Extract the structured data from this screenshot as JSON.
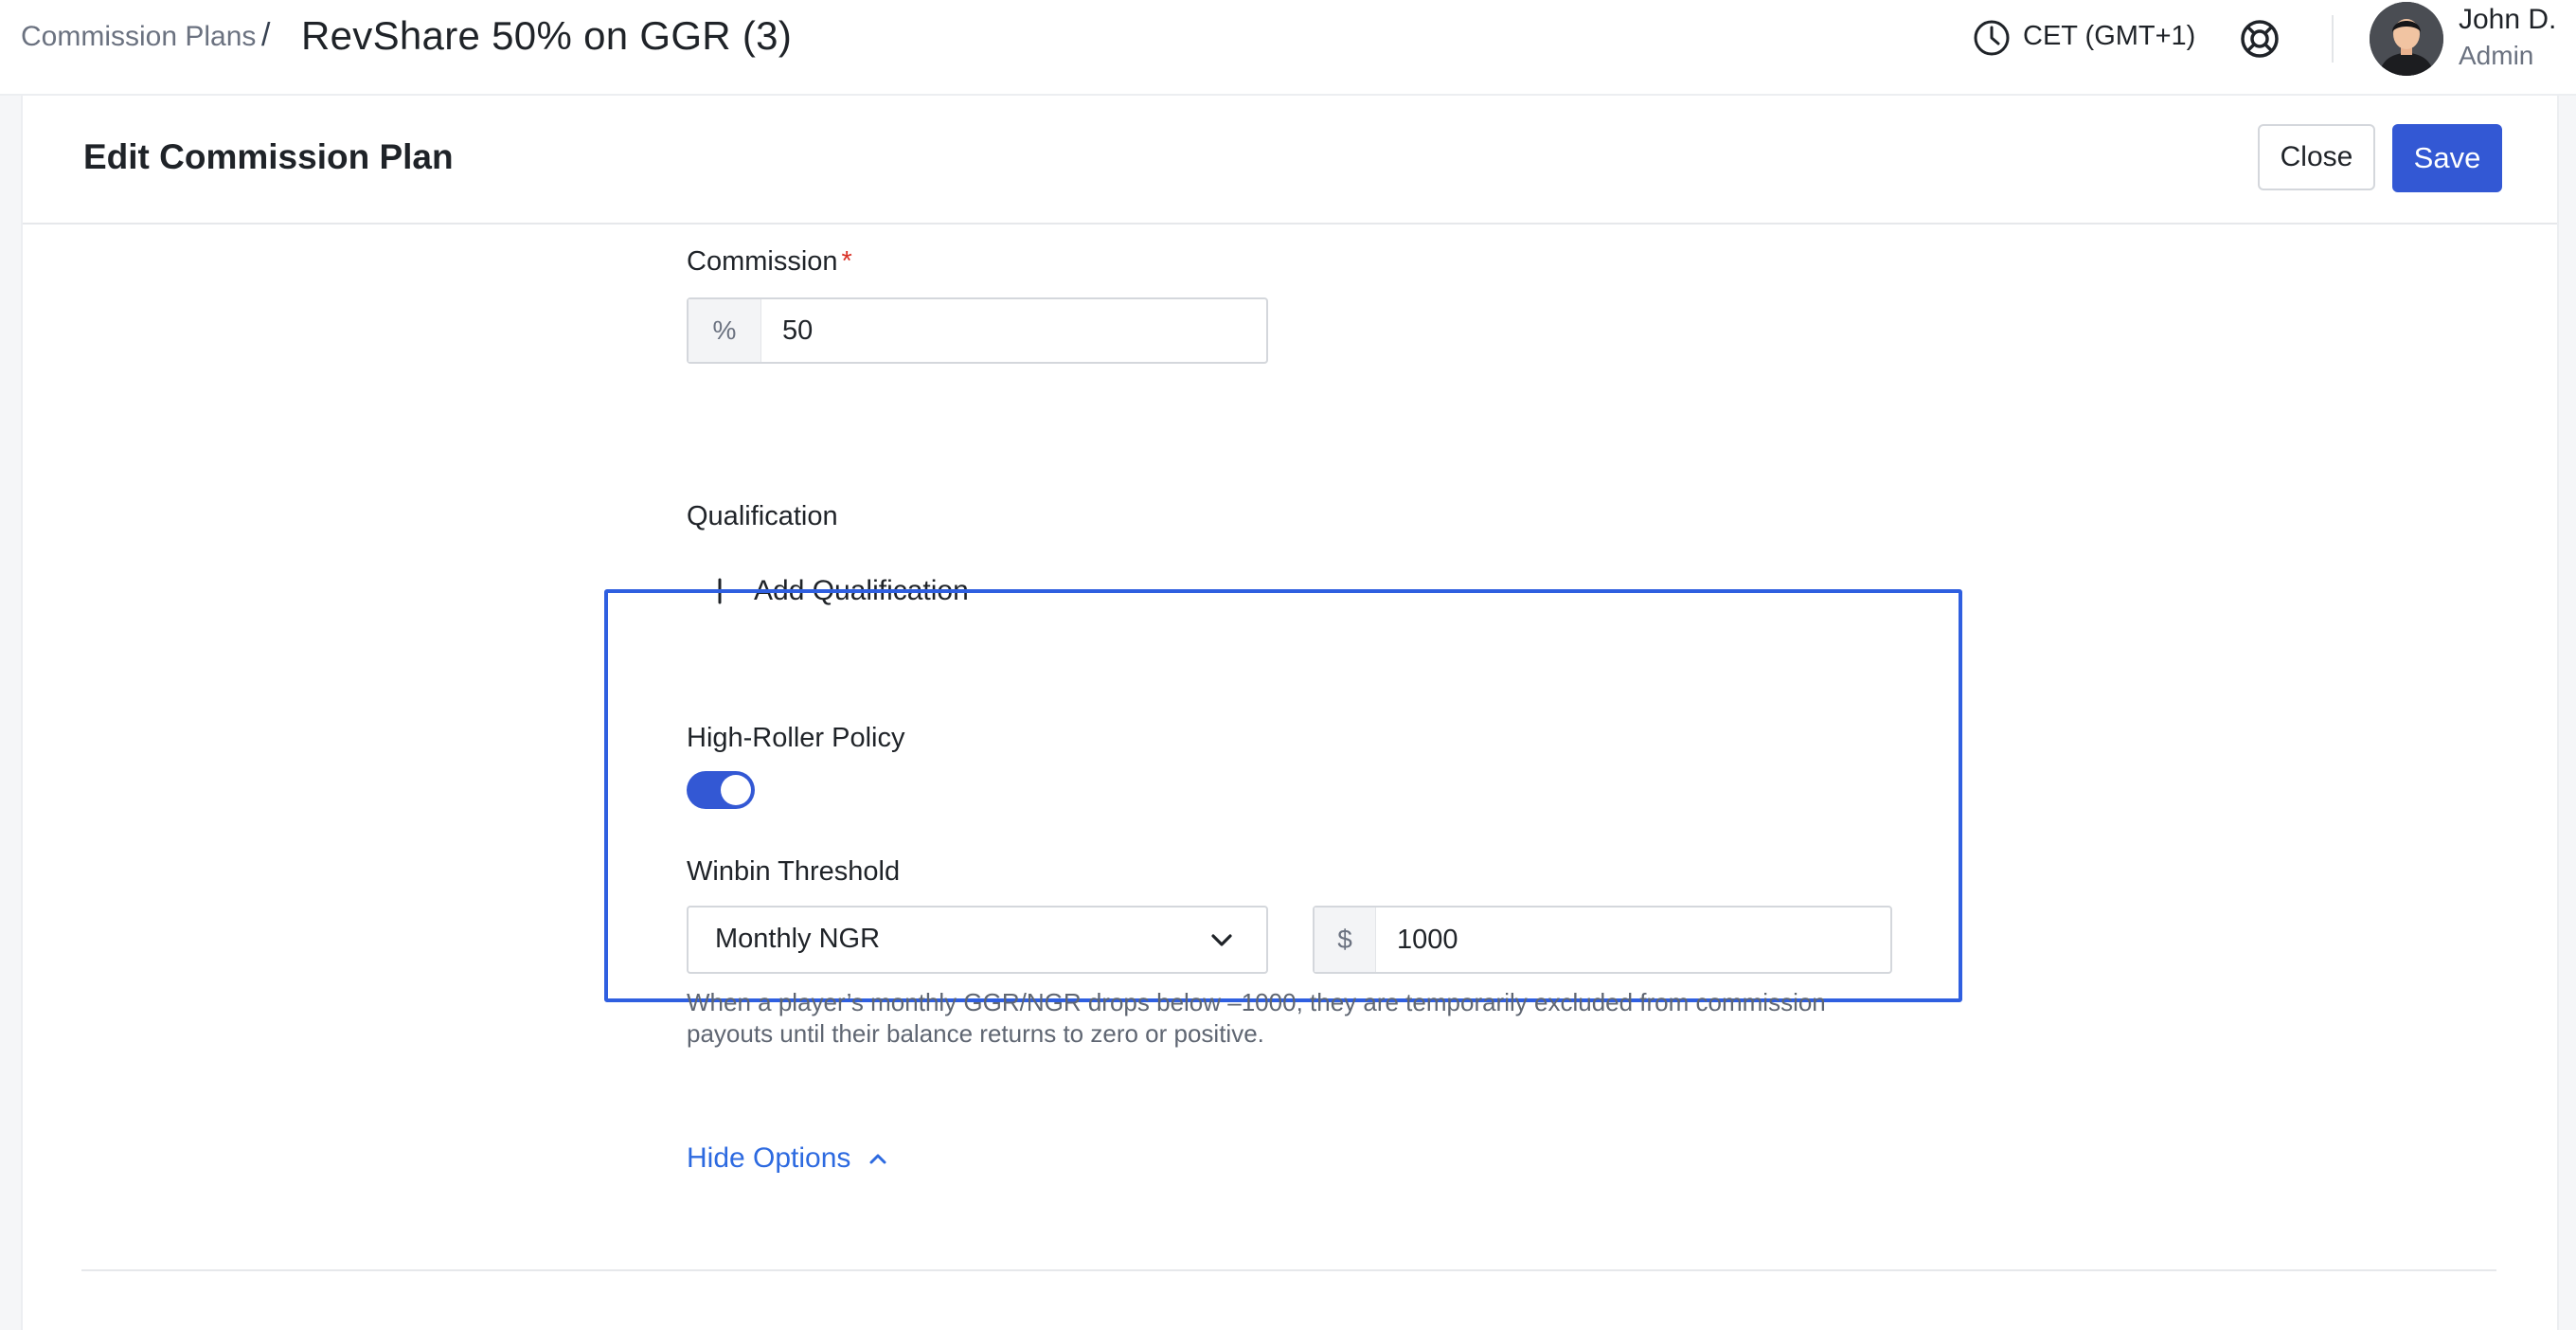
{
  "breadcrumb": {
    "parent": "Commission Plans",
    "separator": "/",
    "title": "RevShare 50% on GGR (3)"
  },
  "header": {
    "timezone": "CET (GMT+1)",
    "user_name": "John D.",
    "user_role": "Admin"
  },
  "panel": {
    "title": "Edit Commission Plan",
    "close_label": "Close",
    "save_label": "Save"
  },
  "commission": {
    "label": "Commission",
    "required_mark": "*",
    "prefix": "%",
    "value": "50"
  },
  "qualification": {
    "label": "Qualification",
    "add_label": "Add Qualification"
  },
  "high_roller": {
    "label": "High-Roller Policy",
    "enabled": true,
    "threshold_label": "Winbin Threshold",
    "threshold_type": "Monthly NGR",
    "amount_prefix": "$",
    "amount": "1000",
    "help_text": "When a player’s monthly GGR/NGR drops below –1000, they are temporarily excluded from commission payouts until their balance returns to zero or positive."
  },
  "options": {
    "hide_label": "Hide Options"
  },
  "colors": {
    "primary": "#3358d4",
    "link": "#2d6ae0",
    "highlight": "#2f5fe0",
    "required": "#d93025"
  },
  "icons": [
    "clock-icon",
    "help-lifebuoy-icon",
    "avatar",
    "plus-icon",
    "chevron-down-icon",
    "chevron-up-icon"
  ]
}
